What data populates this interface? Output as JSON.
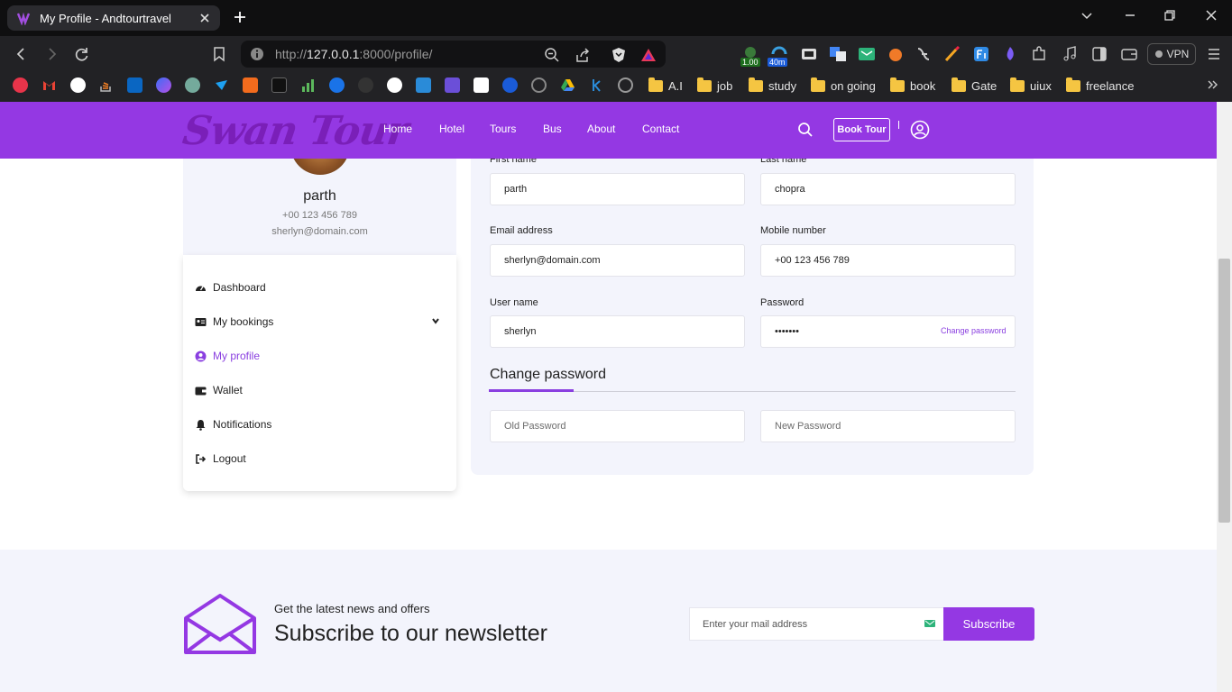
{
  "browser": {
    "tab_title": "My Profile - Andtourtravel",
    "url_scheme": "http://",
    "url_host": "127.0.0.1",
    "url_rest": ":8000/profile/",
    "vpn_label": "VPN",
    "ext_badge_1": "1.00",
    "ext_badge_2": "40m",
    "bookmark_folders": [
      "A.I",
      "job",
      "study",
      "on going",
      "book",
      "Gate",
      "uiux",
      "freelance"
    ]
  },
  "site": {
    "logo": "Swan Tour",
    "nav": [
      "Home",
      "Hotel",
      "Tours",
      "Bus",
      "About",
      "Contact"
    ],
    "book_tour": "Book Tour",
    "accent_color": "#9438e3"
  },
  "profile": {
    "name": "parth",
    "phone": "+00 123 456 789",
    "email": "sherlyn@domain.com"
  },
  "menu": {
    "items": [
      "Dashboard",
      "My bookings",
      "My profile",
      "Wallet",
      "Notifications",
      "Logout"
    ],
    "active": "My profile"
  },
  "form": {
    "first_name_label": "First name",
    "first_name_value": "parth",
    "last_name_label": "Last name",
    "last_name_value": "chopra",
    "email_label": "Email address",
    "email_value": "sherlyn@domain.com",
    "mobile_label": "Mobile number",
    "mobile_value": "+00 123 456 789",
    "username_label": "User name",
    "username_value": "sherlyn",
    "password_label": "Password",
    "password_value": "•••••••",
    "change_password_link": "Change password",
    "change_password_title": "Change password",
    "old_password_placeholder": "Old Password",
    "new_password_placeholder": "New Password"
  },
  "newsletter": {
    "subtitle": "Get the latest news and offers",
    "title": "Subscribe to our newsletter",
    "input_placeholder": "Enter your mail address",
    "button": "Subscribe"
  }
}
